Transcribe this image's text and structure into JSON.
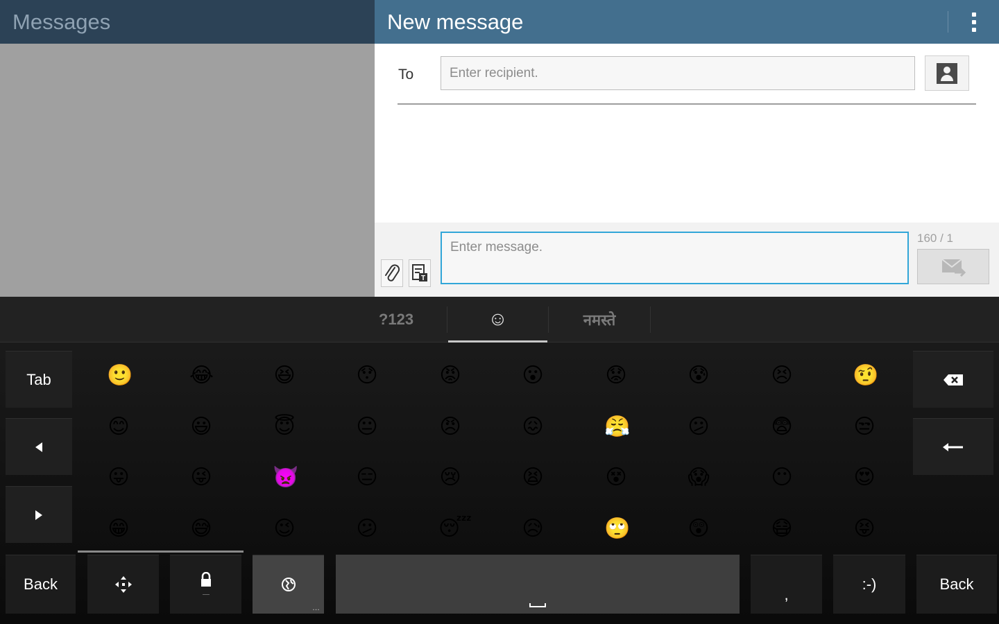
{
  "header": {
    "left_title": "Messages",
    "right_title": "New message",
    "overflow_icon": "more-vertical-icon"
  },
  "compose": {
    "to_label": "To",
    "recipient_placeholder": "Enter recipient.",
    "contact_icon": "contact-icon",
    "message_placeholder": "Enter message.",
    "counter": "160 / 1",
    "attach_icon": "paperclip-icon",
    "template_icon": "text-template-icon",
    "send_icon": "send-disabled-icon"
  },
  "keyboard": {
    "tabs": [
      {
        "label": "?123"
      },
      {
        "label": "☺"
      },
      {
        "label": "नमस्ते"
      }
    ],
    "tab_key": "Tab",
    "back_left": "Back",
    "back_right": "Back",
    "smiley_key": ":-)",
    "comma_key": ",",
    "emoji_rows": [
      [
        "🙂",
        "😂",
        "😆",
        "😯",
        "😡",
        "😮",
        "😟",
        "😰",
        "😣",
        "🤨"
      ],
      [
        "😊",
        "😃",
        "😇",
        "😐",
        "😠",
        "😖",
        "😤",
        "😕",
        "😨",
        "😒"
      ],
      [
        "😛",
        "😜",
        "👿",
        "😑",
        "😢",
        "😫",
        "😵",
        "😱",
        "😶",
        "😍"
      ],
      [
        "😁",
        "😅",
        "😉",
        "😕",
        "😴",
        "😥",
        "🙄",
        "😲",
        "😷",
        "😝"
      ]
    ]
  }
}
